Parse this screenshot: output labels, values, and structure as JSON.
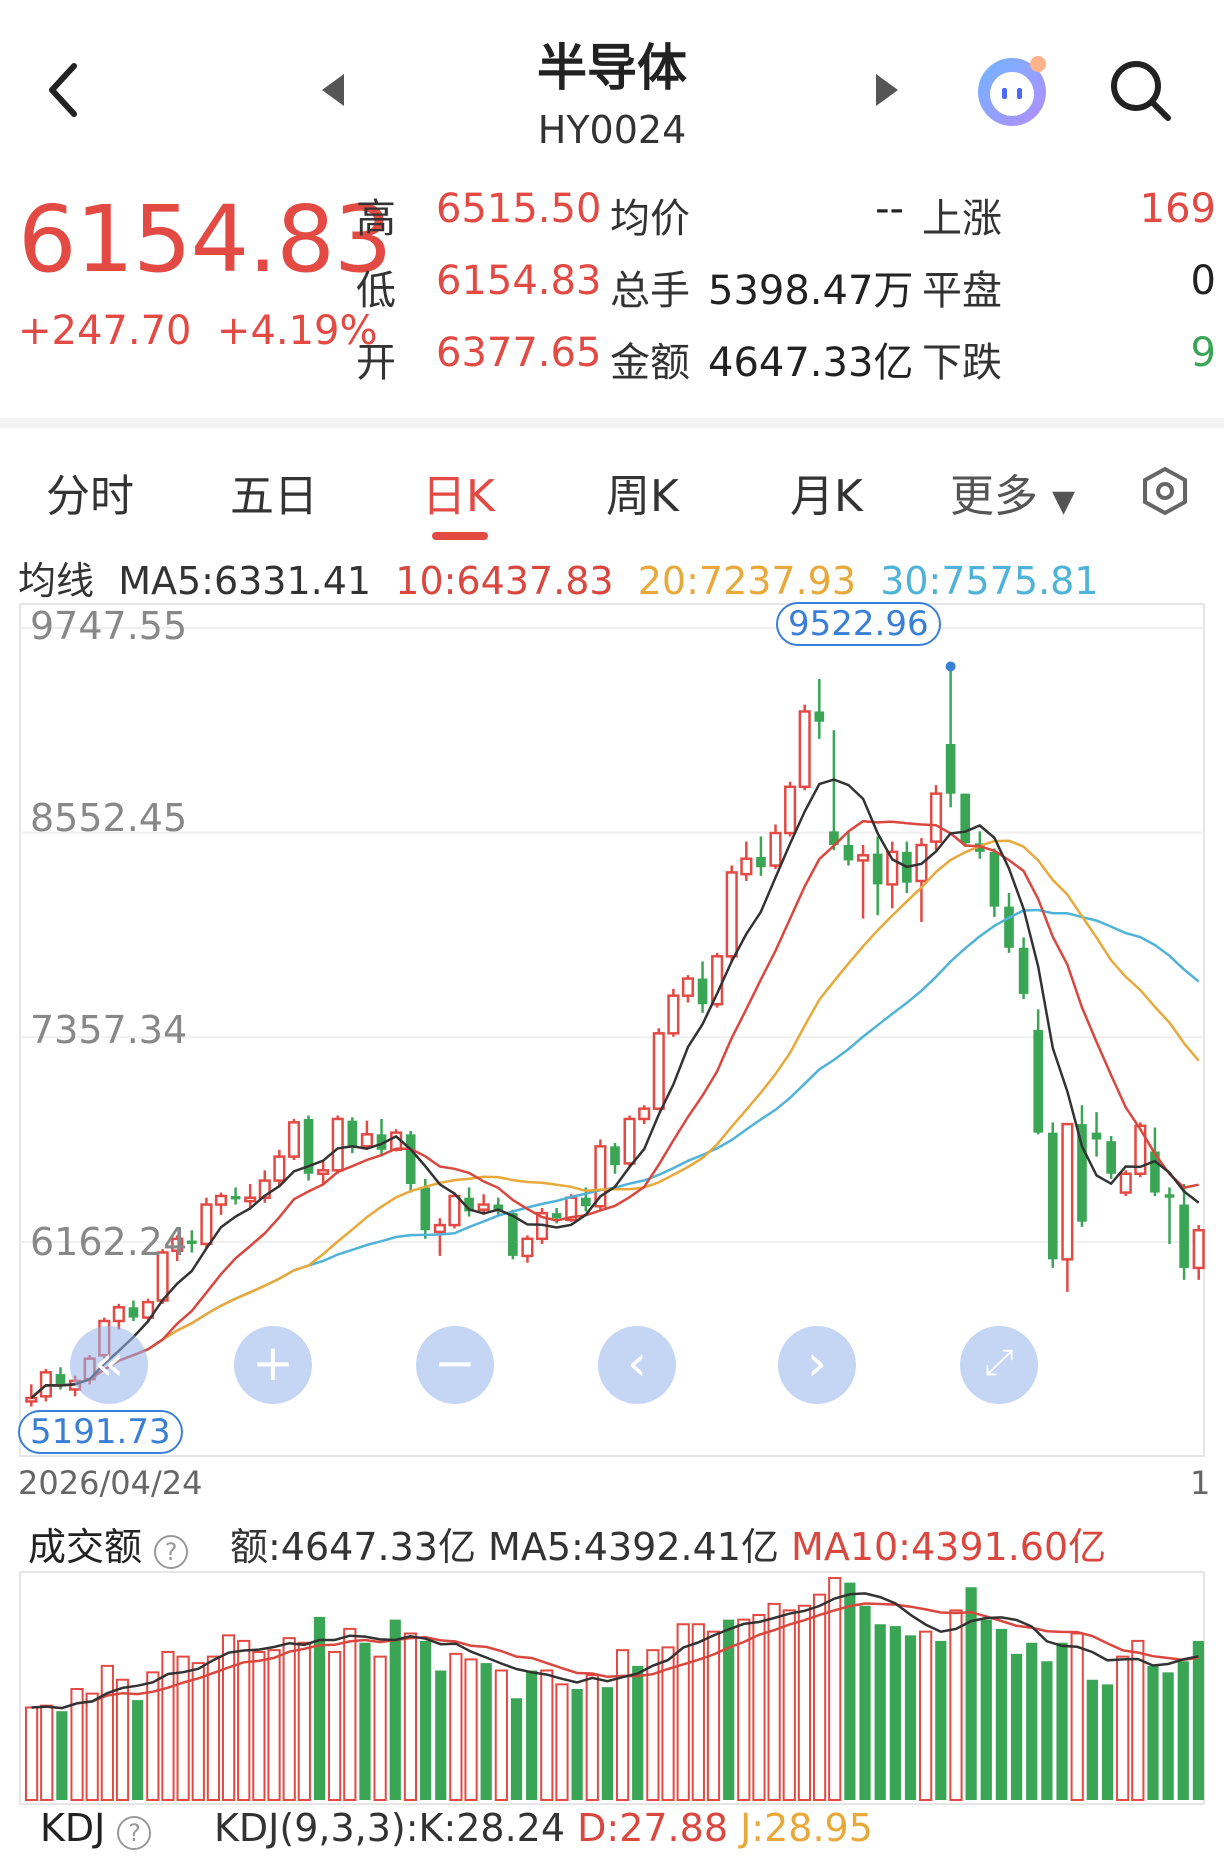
{
  "header": {
    "title": "半导体",
    "code": "HY0024"
  },
  "quote": {
    "price": "6154.83",
    "change": "+247.70",
    "change_pct": "+4.19%",
    "high_label": "高",
    "high": "6515.50",
    "low_label": "低",
    "low": "6154.83",
    "open_label": "开",
    "open": "6377.65",
    "avg_label": "均价",
    "avg": "--",
    "vol_label": "总手",
    "vol": "5398.47万",
    "amt_label": "金额",
    "amt": "4647.33亿",
    "up_label": "上涨",
    "up": "169",
    "flat_label": "平盘",
    "flat": "0",
    "down_label": "下跌",
    "down": "9"
  },
  "tabs": [
    "分时",
    "五日",
    "日K",
    "周K",
    "月K",
    "更多"
  ],
  "ma": {
    "label": "均线",
    "ma5": "MA5:6331.41",
    "ma10": "10:6437.83",
    "ma20": "20:7237.93",
    "ma30": "30:7575.81"
  },
  "axis": {
    "y1": "9747.55",
    "y2": "8552.45",
    "y3": "7357.34",
    "y4": "6162.24",
    "date": "2026/04/24",
    "right_tick": "1"
  },
  "markers": {
    "high": "9522.96",
    "low": "5191.73"
  },
  "volume": {
    "title": "成交额",
    "help": "?",
    "amount": "额:4647.33亿",
    "ma5": "MA5:4392.41亿",
    "ma10": "MA10:4391.60亿"
  },
  "kdj": {
    "title": "KDJ",
    "help": "?",
    "params": "KDJ(9,3,3):",
    "k": "K:28.24",
    "d": "D:27.88",
    "j": "J:28.95"
  },
  "colors": {
    "up": "#e24a43",
    "down": "#3aa655",
    "ma5": "#333333",
    "ma10": "#d9473f",
    "ma20": "#e8a93a",
    "ma30": "#4fb3d9"
  },
  "controls": [
    "rewind-icon",
    "zoom-in-icon",
    "zoom-out-icon",
    "left-icon",
    "right-icon",
    "fullscreen-icon"
  ],
  "chart_data": {
    "type": "candlestick",
    "ylim": [
      5191.73,
      9747.55
    ],
    "candles": [
      {
        "o": 5230,
        "h": 5330,
        "l": 5200,
        "c": 5250
      },
      {
        "o": 5260,
        "h": 5420,
        "l": 5230,
        "c": 5400
      },
      {
        "o": 5390,
        "h": 5430,
        "l": 5300,
        "c": 5320
      },
      {
        "o": 5300,
        "h": 5380,
        "l": 5260,
        "c": 5350
      },
      {
        "o": 5360,
        "h": 5500,
        "l": 5330,
        "c": 5480
      },
      {
        "o": 5500,
        "h": 5720,
        "l": 5480,
        "c": 5700
      },
      {
        "o": 5700,
        "h": 5800,
        "l": 5650,
        "c": 5780
      },
      {
        "o": 5780,
        "h": 5820,
        "l": 5700,
        "c": 5720
      },
      {
        "o": 5720,
        "h": 5830,
        "l": 5690,
        "c": 5810
      },
      {
        "o": 5820,
        "h": 6120,
        "l": 5800,
        "c": 6100
      },
      {
        "o": 6110,
        "h": 6200,
        "l": 6050,
        "c": 6180
      },
      {
        "o": 6170,
        "h": 6230,
        "l": 6100,
        "c": 6150
      },
      {
        "o": 6150,
        "h": 6420,
        "l": 6120,
        "c": 6380
      },
      {
        "o": 6380,
        "h": 6450,
        "l": 6320,
        "c": 6430
      },
      {
        "o": 6430,
        "h": 6480,
        "l": 6380,
        "c": 6410
      },
      {
        "o": 6400,
        "h": 6500,
        "l": 6350,
        "c": 6420
      },
      {
        "o": 6420,
        "h": 6580,
        "l": 6390,
        "c": 6520
      },
      {
        "o": 6520,
        "h": 6700,
        "l": 6480,
        "c": 6660
      },
      {
        "o": 6660,
        "h": 6880,
        "l": 6640,
        "c": 6860
      },
      {
        "o": 6880,
        "h": 6900,
        "l": 6520,
        "c": 6560
      },
      {
        "o": 6560,
        "h": 6640,
        "l": 6500,
        "c": 6580
      },
      {
        "o": 6580,
        "h": 6900,
        "l": 6560,
        "c": 6880
      },
      {
        "o": 6870,
        "h": 6890,
        "l": 6680,
        "c": 6720
      },
      {
        "o": 6720,
        "h": 6870,
        "l": 6700,
        "c": 6790
      },
      {
        "o": 6790,
        "h": 6880,
        "l": 6660,
        "c": 6700
      },
      {
        "o": 6700,
        "h": 6820,
        "l": 6690,
        "c": 6800
      },
      {
        "o": 6790,
        "h": 6810,
        "l": 6450,
        "c": 6500
      },
      {
        "o": 6480,
        "h": 6530,
        "l": 6180,
        "c": 6230
      },
      {
        "o": 6220,
        "h": 6300,
        "l": 6080,
        "c": 6260
      },
      {
        "o": 6260,
        "h": 6450,
        "l": 6240,
        "c": 6430
      },
      {
        "o": 6420,
        "h": 6480,
        "l": 6310,
        "c": 6340
      },
      {
        "o": 6350,
        "h": 6440,
        "l": 6320,
        "c": 6380
      },
      {
        "o": 6380,
        "h": 6420,
        "l": 6320,
        "c": 6340
      },
      {
        "o": 6330,
        "h": 6350,
        "l": 6060,
        "c": 6080
      },
      {
        "o": 6080,
        "h": 6200,
        "l": 6040,
        "c": 6180
      },
      {
        "o": 6180,
        "h": 6360,
        "l": 6150,
        "c": 6330
      },
      {
        "o": 6330,
        "h": 6360,
        "l": 6270,
        "c": 6300
      },
      {
        "o": 6290,
        "h": 6440,
        "l": 6280,
        "c": 6420
      },
      {
        "o": 6420,
        "h": 6480,
        "l": 6340,
        "c": 6370
      },
      {
        "o": 6370,
        "h": 6760,
        "l": 6350,
        "c": 6720
      },
      {
        "o": 6720,
        "h": 6740,
        "l": 6560,
        "c": 6610
      },
      {
        "o": 6620,
        "h": 6900,
        "l": 6600,
        "c": 6880
      },
      {
        "o": 6880,
        "h": 6960,
        "l": 6850,
        "c": 6940
      },
      {
        "o": 6940,
        "h": 7410,
        "l": 6930,
        "c": 7380
      },
      {
        "o": 7380,
        "h": 7640,
        "l": 7360,
        "c": 7600
      },
      {
        "o": 7600,
        "h": 7720,
        "l": 7560,
        "c": 7700
      },
      {
        "o": 7700,
        "h": 7800,
        "l": 7500,
        "c": 7550
      },
      {
        "o": 7550,
        "h": 7850,
        "l": 7530,
        "c": 7830
      },
      {
        "o": 7830,
        "h": 8360,
        "l": 7800,
        "c": 8320
      },
      {
        "o": 8310,
        "h": 8500,
        "l": 8270,
        "c": 8400
      },
      {
        "o": 8410,
        "h": 8530,
        "l": 8300,
        "c": 8350
      },
      {
        "o": 8360,
        "h": 8600,
        "l": 8340,
        "c": 8550
      },
      {
        "o": 8550,
        "h": 8850,
        "l": 8530,
        "c": 8820
      },
      {
        "o": 8820,
        "h": 9300,
        "l": 8800,
        "c": 9260
      },
      {
        "o": 9260,
        "h": 9450,
        "l": 9100,
        "c": 9200
      },
      {
        "o": 8560,
        "h": 9150,
        "l": 8450,
        "c": 8480
      },
      {
        "o": 8480,
        "h": 8560,
        "l": 8360,
        "c": 8390
      },
      {
        "o": 8390,
        "h": 8480,
        "l": 8050,
        "c": 8420
      },
      {
        "o": 8430,
        "h": 8530,
        "l": 8070,
        "c": 8250
      },
      {
        "o": 8250,
        "h": 8500,
        "l": 8110,
        "c": 8440
      },
      {
        "o": 8440,
        "h": 8500,
        "l": 8200,
        "c": 8260
      },
      {
        "o": 8270,
        "h": 8520,
        "l": 8030,
        "c": 8480
      },
      {
        "o": 8500,
        "h": 8830,
        "l": 8450,
        "c": 8780
      },
      {
        "o": 9070,
        "h": 9522.96,
        "l": 8700,
        "c": 8780
      },
      {
        "o": 8780,
        "h": 8780,
        "l": 8470,
        "c": 8490
      },
      {
        "o": 8490,
        "h": 8560,
        "l": 8400,
        "c": 8440
      },
      {
        "o": 8440,
        "h": 8460,
        "l": 8060,
        "c": 8120
      },
      {
        "o": 8120,
        "h": 8200,
        "l": 7850,
        "c": 7880
      },
      {
        "o": 7880,
        "h": 7940,
        "l": 7580,
        "c": 7610
      },
      {
        "o": 7400,
        "h": 7520,
        "l": 6790,
        "c": 6800
      },
      {
        "o": 6800,
        "h": 6860,
        "l": 6010,
        "c": 6060
      },
      {
        "o": 6060,
        "h": 6820,
        "l": 5870,
        "c": 6850
      },
      {
        "o": 6850,
        "h": 6960,
        "l": 6250,
        "c": 6280
      },
      {
        "o": 6800,
        "h": 6920,
        "l": 6660,
        "c": 6760
      },
      {
        "o": 6750,
        "h": 6780,
        "l": 6530,
        "c": 6560
      },
      {
        "o": 6450,
        "h": 6580,
        "l": 6430,
        "c": 6560
      },
      {
        "o": 6560,
        "h": 6860,
        "l": 6540,
        "c": 6840
      },
      {
        "o": 6690,
        "h": 6830,
        "l": 6430,
        "c": 6450
      },
      {
        "o": 6440,
        "h": 6480,
        "l": 6150,
        "c": 6420
      },
      {
        "o": 6380,
        "h": 6500,
        "l": 5940,
        "c": 6010
      },
      {
        "o": 6010,
        "h": 6260,
        "l": 5940,
        "c": 6230
      }
    ],
    "volume": [
      {
        "v": 1.0,
        "up": true
      },
      {
        "v": 1.02,
        "up": true
      },
      {
        "v": 0.96,
        "up": false
      },
      {
        "v": 1.2,
        "up": true
      },
      {
        "v": 1.15,
        "up": true
      },
      {
        "v": 1.45,
        "up": true
      },
      {
        "v": 1.3,
        "up": true
      },
      {
        "v": 1.08,
        "up": false
      },
      {
        "v": 1.38,
        "up": true
      },
      {
        "v": 1.6,
        "up": true
      },
      {
        "v": 1.55,
        "up": true
      },
      {
        "v": 1.48,
        "up": true
      },
      {
        "v": 1.55,
        "up": true
      },
      {
        "v": 1.78,
        "up": true
      },
      {
        "v": 1.72,
        "up": true
      },
      {
        "v": 1.6,
        "up": true
      },
      {
        "v": 1.62,
        "up": true
      },
      {
        "v": 1.75,
        "up": true
      },
      {
        "v": 1.7,
        "up": true
      },
      {
        "v": 1.98,
        "up": false
      },
      {
        "v": 1.6,
        "up": true
      },
      {
        "v": 1.85,
        "up": true
      },
      {
        "v": 1.7,
        "up": false
      },
      {
        "v": 1.55,
        "up": true
      },
      {
        "v": 1.95,
        "up": false
      },
      {
        "v": 1.8,
        "up": true
      },
      {
        "v": 1.72,
        "up": false
      },
      {
        "v": 1.4,
        "up": false
      },
      {
        "v": 1.58,
        "up": true
      },
      {
        "v": 1.52,
        "up": true
      },
      {
        "v": 1.48,
        "up": false
      },
      {
        "v": 1.4,
        "up": true
      },
      {
        "v": 1.1,
        "up": false
      },
      {
        "v": 1.4,
        "up": false
      },
      {
        "v": 1.4,
        "up": true
      },
      {
        "v": 1.25,
        "up": true
      },
      {
        "v": 1.2,
        "up": false
      },
      {
        "v": 1.35,
        "up": true
      },
      {
        "v": 1.22,
        "up": false
      },
      {
        "v": 1.62,
        "up": true
      },
      {
        "v": 1.45,
        "up": false
      },
      {
        "v": 1.62,
        "up": true
      },
      {
        "v": 1.65,
        "up": true
      },
      {
        "v": 1.9,
        "up": true
      },
      {
        "v": 1.9,
        "up": true
      },
      {
        "v": 1.82,
        "up": true
      },
      {
        "v": 1.95,
        "up": false
      },
      {
        "v": 1.95,
        "up": true
      },
      {
        "v": 2.0,
        "up": true
      },
      {
        "v": 2.12,
        "up": true
      },
      {
        "v": 2.05,
        "up": true
      },
      {
        "v": 2.1,
        "up": true
      },
      {
        "v": 2.22,
        "up": true
      },
      {
        "v": 2.4,
        "up": true
      },
      {
        "v": 2.35,
        "up": false
      },
      {
        "v": 2.1,
        "up": false
      },
      {
        "v": 1.9,
        "up": false
      },
      {
        "v": 1.88,
        "up": false
      },
      {
        "v": 1.78,
        "up": false
      },
      {
        "v": 1.82,
        "up": true
      },
      {
        "v": 1.72,
        "up": false
      },
      {
        "v": 2.05,
        "up": true
      },
      {
        "v": 2.3,
        "up": false
      },
      {
        "v": 1.95,
        "up": false
      },
      {
        "v": 1.85,
        "up": false
      },
      {
        "v": 1.58,
        "up": false
      },
      {
        "v": 1.7,
        "up": false
      },
      {
        "v": 1.5,
        "up": false
      },
      {
        "v": 1.7,
        "up": false
      },
      {
        "v": 1.8,
        "up": true
      },
      {
        "v": 1.3,
        "up": false
      },
      {
        "v": 1.25,
        "up": false
      },
      {
        "v": 1.55,
        "up": true
      },
      {
        "v": 1.72,
        "up": true
      },
      {
        "v": 1.45,
        "up": false
      },
      {
        "v": 1.38,
        "up": false
      },
      {
        "v": 1.5,
        "up": false
      },
      {
        "v": 1.72,
        "up": false
      }
    ]
  }
}
